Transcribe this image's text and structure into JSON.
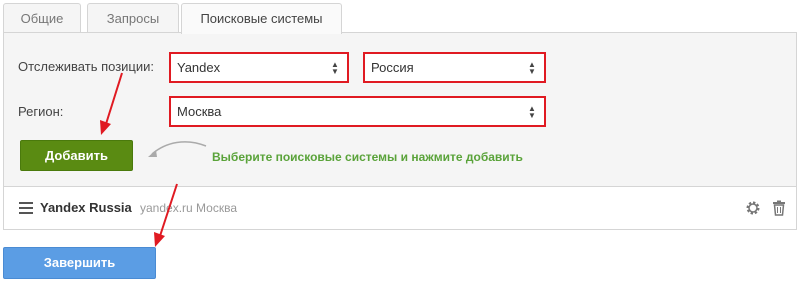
{
  "tabs": [
    {
      "label": "Общие"
    },
    {
      "label": "Запросы"
    },
    {
      "label": "Поисковые системы",
      "active": true
    }
  ],
  "form": {
    "track_label": "Отслеживать позиции:",
    "engine_value": "Yandex",
    "country_value": "Россия",
    "region_label": "Регион:",
    "city_value": "Москва",
    "add_button": "Добавить",
    "hint": "Выберите поисковые системы и нажмите добавить"
  },
  "list": {
    "item": {
      "name": "Yandex Russia",
      "meta": "yandex.ru Москва"
    }
  },
  "footer": {
    "finish_button": "Завершить"
  },
  "colors": {
    "highlight": "#e01a22",
    "add_button": "#5a8b12",
    "finish_button": "#5b9de4",
    "hint": "#5aa33a"
  },
  "icons": [
    "select-arrows-icon",
    "drag-handle-icon",
    "gear-icon",
    "trash-icon",
    "curved-arrow-icon",
    "red-arrow-icon"
  ]
}
